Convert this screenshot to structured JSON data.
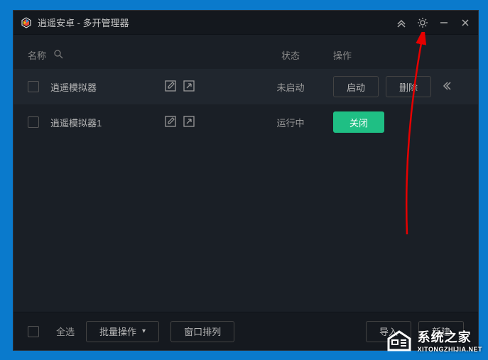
{
  "title": "逍遥安卓 - 多开管理器",
  "columns": {
    "name": "名称",
    "status": "状态",
    "action": "操作"
  },
  "rows": [
    {
      "name": "逍遥模拟器",
      "status": "未启动",
      "btn1": "启动",
      "btn2": "删除"
    },
    {
      "name": "逍遥模拟器1",
      "status": "运行中",
      "btn1": "关闭"
    }
  ],
  "footer": {
    "select_all": "全选",
    "batch": "批量操作",
    "arrange": "窗口排列",
    "import": "导入",
    "new": "新建"
  },
  "watermark": {
    "cn": "系统之家",
    "en": "XITONGZHIJIA.NET"
  }
}
